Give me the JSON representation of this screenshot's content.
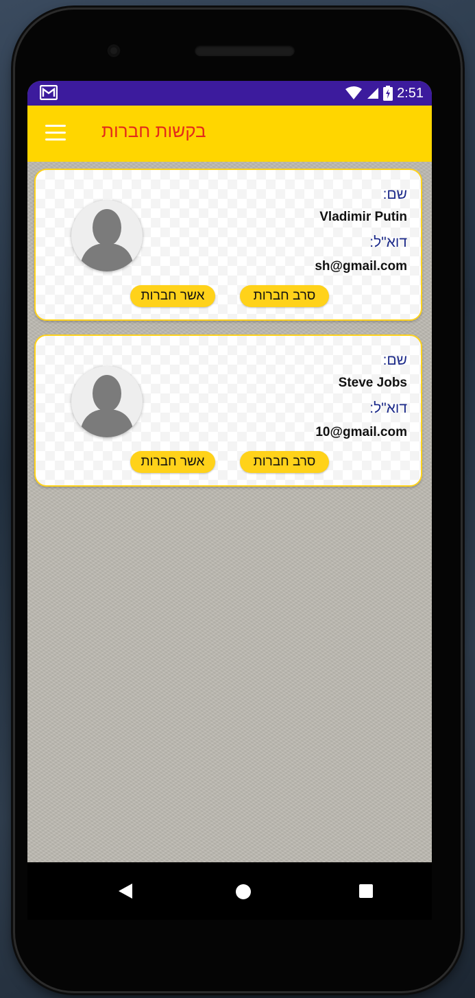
{
  "status_bar": {
    "time": "2:51",
    "icons": [
      "gmail-icon",
      "wifi-icon",
      "signal-icon",
      "battery-icon"
    ]
  },
  "toolbar": {
    "title": "בקשות חברות",
    "menu_icon": "hamburger-menu-icon"
  },
  "requests": [
    {
      "name_label": "שם:",
      "name": "Vladimir Putin",
      "email_label": "דוא\"ל:",
      "email": "sh@gmail.com",
      "reject_label": "סרב חברות",
      "approve_label": "אשר חברות"
    },
    {
      "name_label": "שם:",
      "name": "Steve Jobs",
      "email_label": "דוא\"ל:",
      "email": "10@gmail.com",
      "reject_label": "סרב חברות",
      "approve_label": "אשר חברות"
    }
  ],
  "nav": {
    "icons": [
      "back-icon",
      "home-icon",
      "recents-icon"
    ]
  },
  "colors": {
    "status_bar": "#3c1b9d",
    "toolbar": "#ffd600",
    "title": "#e32a1a",
    "label": "#1c2a8a",
    "button": "#ffd21a",
    "card_border": "#ffd21a"
  }
}
